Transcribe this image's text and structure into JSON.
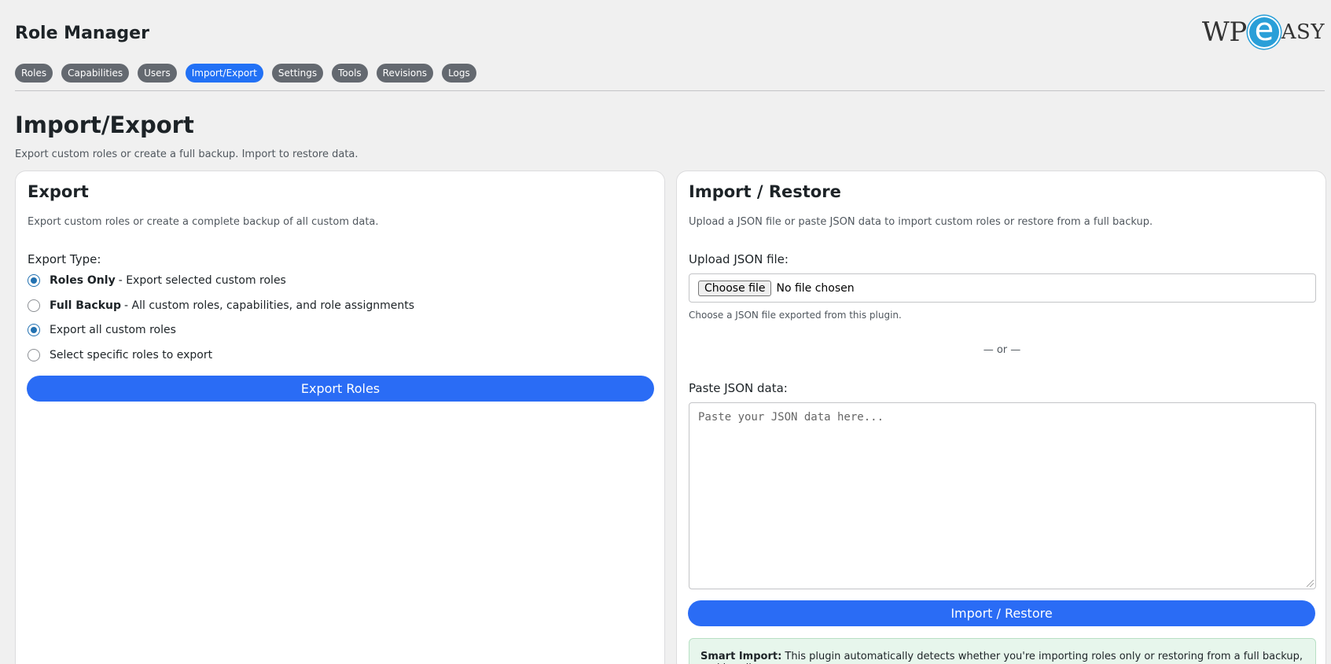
{
  "header": {
    "app_title": "Role Manager",
    "logo": {
      "wp": "WP",
      "e": "e",
      "asy": "ASY"
    }
  },
  "tabs": [
    {
      "label": "Roles",
      "active": false
    },
    {
      "label": "Capabilities",
      "active": false
    },
    {
      "label": "Users",
      "active": false
    },
    {
      "label": "Import/Export",
      "active": true
    },
    {
      "label": "Settings",
      "active": false
    },
    {
      "label": "Tools",
      "active": false
    },
    {
      "label": "Revisions",
      "active": false
    },
    {
      "label": "Logs",
      "active": false
    }
  ],
  "page": {
    "title": "Import/Export",
    "description": "Export custom roles or create a full backup. Import to restore data."
  },
  "export": {
    "title": "Export",
    "description": "Export custom roles or create a complete backup of all custom data.",
    "type_label": "Export Type:",
    "options": [
      {
        "bold": "Roles Only",
        "text": "- Export selected custom roles",
        "checked": true
      },
      {
        "bold": "Full Backup",
        "text": "- All custom roles, capabilities, and role assignments",
        "checked": false
      },
      {
        "bold": "",
        "text": "Export all custom roles",
        "checked": true
      },
      {
        "bold": "",
        "text": "Select specific roles to export",
        "checked": false
      }
    ],
    "button_label": "Export Roles"
  },
  "import": {
    "title": "Import / Restore",
    "description": "Upload a JSON file or paste JSON data to import custom roles or restore from a full backup.",
    "upload_label": "Upload JSON file:",
    "choose_file_label": "Choose file",
    "file_status": "No file chosen",
    "upload_hint": "Choose a JSON file exported from this plugin.",
    "or_text": "— or —",
    "paste_label": "Paste JSON data:",
    "paste_placeholder": "Paste your JSON data here...",
    "button_label": "Import / Restore",
    "notice_bold": "Smart Import:",
    "notice_text": "This plugin automatically detects whether you're importing roles only or restoring from a full backup, and handles"
  },
  "colors": {
    "accent": "#2a6cf5",
    "tab_inactive": "#646970",
    "notice_bg": "#e7f6ec"
  }
}
